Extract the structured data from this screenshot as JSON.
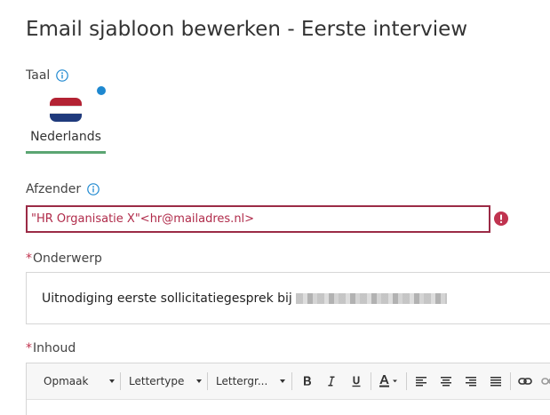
{
  "page": {
    "title": "Email sjabloon bewerken - Eerste interview"
  },
  "language": {
    "label": "Taal",
    "tabs": [
      {
        "name": "Nederlands",
        "active": true,
        "flag": "netherlands-flag-icon"
      }
    ]
  },
  "sender": {
    "label": "Afzender",
    "value": "\"HR Organisatie X\"<hr@mailadres.nl>",
    "has_error": true
  },
  "subject": {
    "required_mark": "*",
    "label": "Onderwerp",
    "value": "Uitnodiging eerste sollicitatiegesprek bij"
  },
  "content": {
    "required_mark": "*",
    "label": "Inhoud",
    "toolbar": {
      "format_label": "Opmaak",
      "font_label": "Lettertype",
      "size_label": "Lettergr...",
      "buttons": [
        "bold-icon",
        "italic-icon",
        "underline-icon",
        "text-color-icon",
        "align-left-icon",
        "align-center-icon",
        "align-right-icon",
        "align-justify-icon",
        "link-icon",
        "unlink-icon"
      ]
    }
  },
  "colors": {
    "error": "#9b2b46",
    "active_tab_underline": "#5ba572",
    "info_blue": "#1e88d0"
  }
}
